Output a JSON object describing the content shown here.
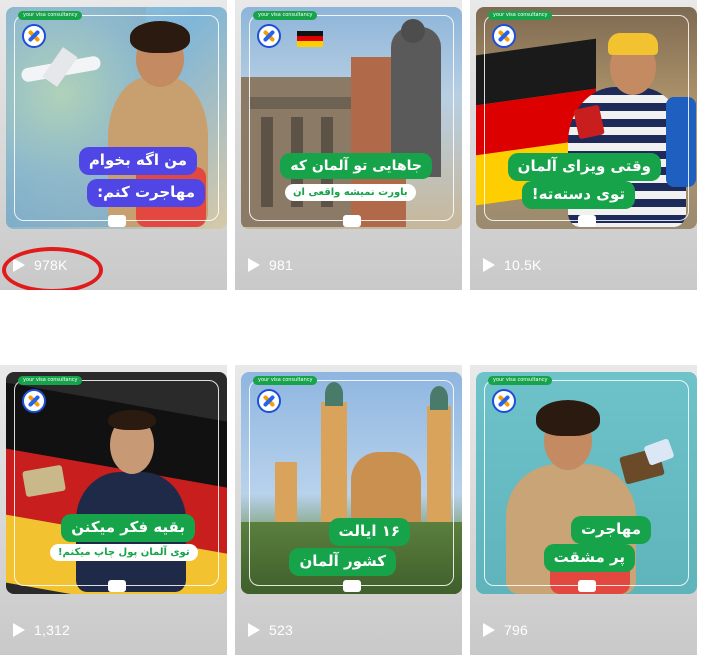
{
  "posts": [
    {
      "id": "post1",
      "headline": "من اگه بخوام",
      "headline2": "مهاجرت کنم:",
      "views": "978K",
      "accent": "#4f46e5"
    },
    {
      "id": "post2",
      "headline": "جاهایی تو آلمان که",
      "sub": "باورت نمیشه واقعی ان",
      "views": "981",
      "accent": "#16a34a"
    },
    {
      "id": "post3",
      "headline": "وقتی ویزای آلمان",
      "headline2": "توی دسته‌ته!",
      "views": "10.5K",
      "accent": "#16a34a"
    },
    {
      "id": "post4",
      "headline": "بقیه فکر میکنن",
      "sub": "توی آلمان پول چاپ میکنم!",
      "views": "1,312",
      "accent": "#16a34a"
    },
    {
      "id": "post5",
      "headline": "۱۶ ایالت",
      "headline2": "کشور آلمان",
      "views": "523",
      "accent": "#16a34a"
    },
    {
      "id": "post6",
      "headline": "مهاجرت",
      "headline2": "پر مشقت",
      "views": "796",
      "accent": "#16a34a"
    }
  ],
  "brand_badge": "your visa consultancy",
  "colors": {
    "highlight_circle": "#e01b1b",
    "badge_green": "#16a34a",
    "count_text": "#ffffff"
  },
  "icons": {
    "play": "play-icon",
    "logo": "brand-logo-icon"
  }
}
